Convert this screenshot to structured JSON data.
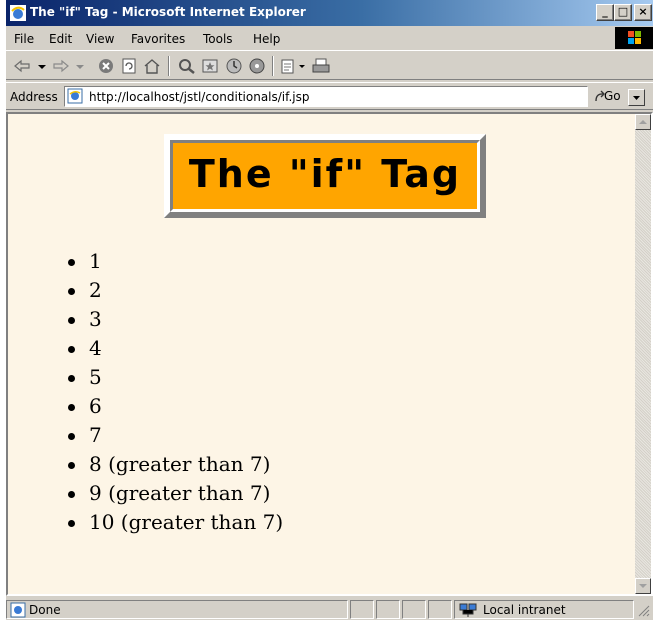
{
  "window": {
    "title": "The \"if\" Tag - Microsoft Internet Explorer"
  },
  "window_buttons": {
    "minimize": "_",
    "maximize": "□",
    "close": "×"
  },
  "menu": [
    "File",
    "Edit",
    "View",
    "Favorites",
    "Tools",
    "Help"
  ],
  "toolbar": {
    "icons": [
      "back-icon",
      "forward-icon",
      "stop-icon",
      "refresh-icon",
      "home-icon",
      "search-icon",
      "favorites-icon",
      "history-icon",
      "mail-icon",
      "print-icon"
    ]
  },
  "address": {
    "label": "Address",
    "url": "http://localhost/jstl/conditionals/if.jsp",
    "go": "Go"
  },
  "page": {
    "heading": "The \"if\" Tag",
    "items": [
      "1",
      "2",
      "3",
      "4",
      "5",
      "6",
      "7",
      "8 (greater than 7)",
      "9 (greater than 7)",
      "10 (greater than 7)"
    ]
  },
  "status": {
    "text": "Done",
    "zone": "Local intranet"
  },
  "colors": {
    "page_background": "#fdf5e6",
    "heading_background": "#ffa500",
    "titlebar": "#0a246a"
  }
}
